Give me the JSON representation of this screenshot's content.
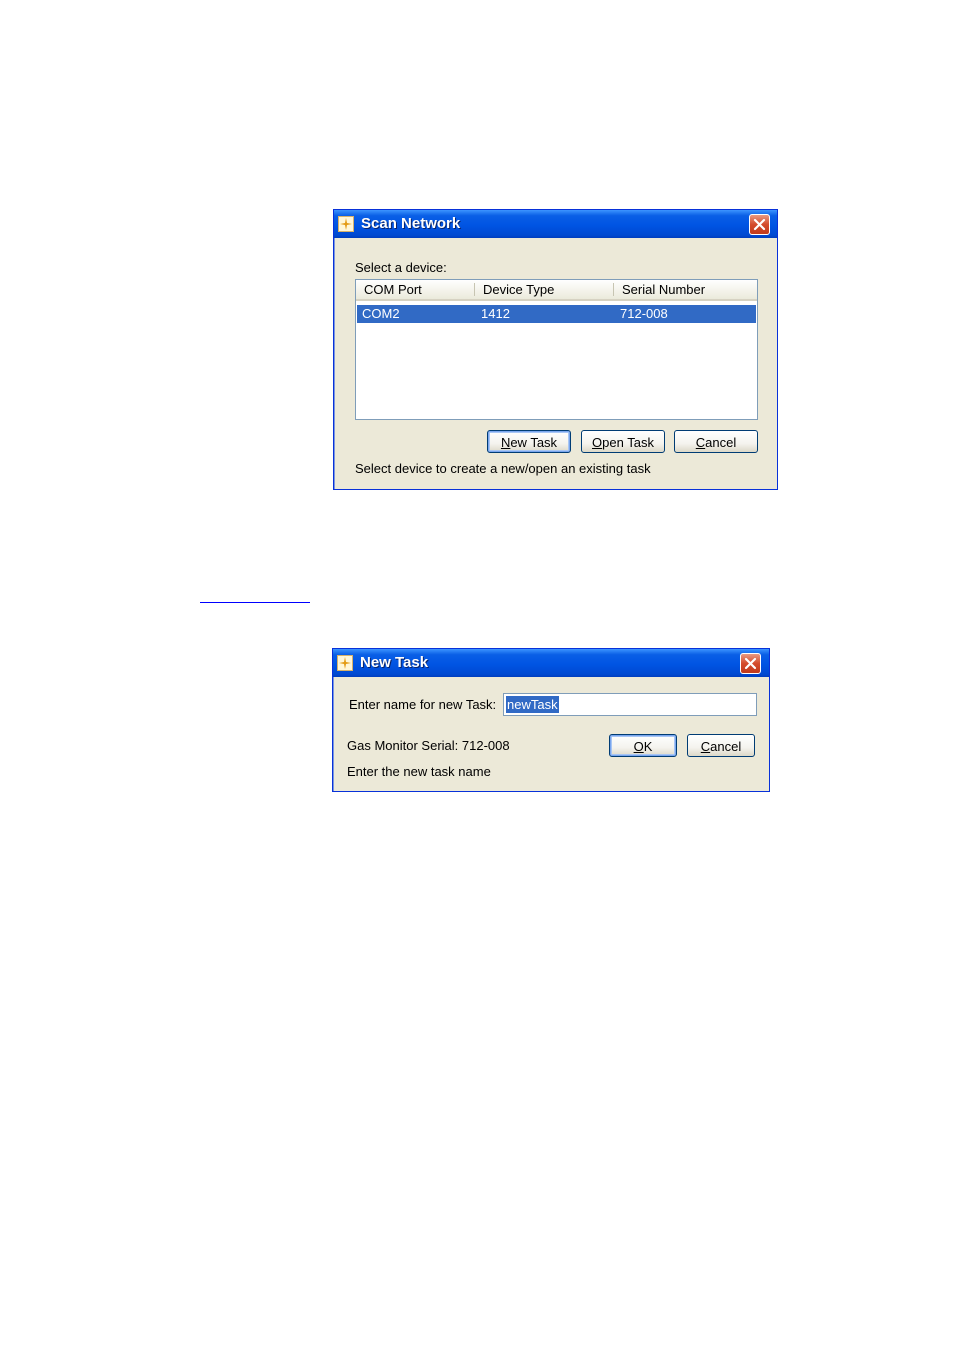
{
  "scan_network": {
    "title": "Scan Network",
    "select_label": "Select a device:",
    "columns": [
      "COM Port",
      "Device Type",
      "Serial Number"
    ],
    "rows": [
      {
        "com_port": "COM2",
        "device_type": "1412",
        "serial_number": "712-008",
        "selected": true
      }
    ],
    "new_task_label": "New Task",
    "open_task_label": "Open Task",
    "cancel_label": "Cancel",
    "status_text": "Select device to create a new/open an existing task"
  },
  "new_task": {
    "title": "New Task",
    "name_label": "Enter name for new Task:",
    "name_value": "newTask",
    "serial_text": "Gas Monitor Serial: 712-008",
    "ok_label": "OK",
    "cancel_label": "Cancel",
    "hint_text": "Enter the new task name"
  },
  "icons": {
    "app": "app-icon",
    "close": "close-icon"
  },
  "colors": {
    "titlebar": "#0054e3",
    "selection": "#316ac5",
    "dialog_bg": "#ece9d8",
    "close_button": "#d44b2c"
  }
}
